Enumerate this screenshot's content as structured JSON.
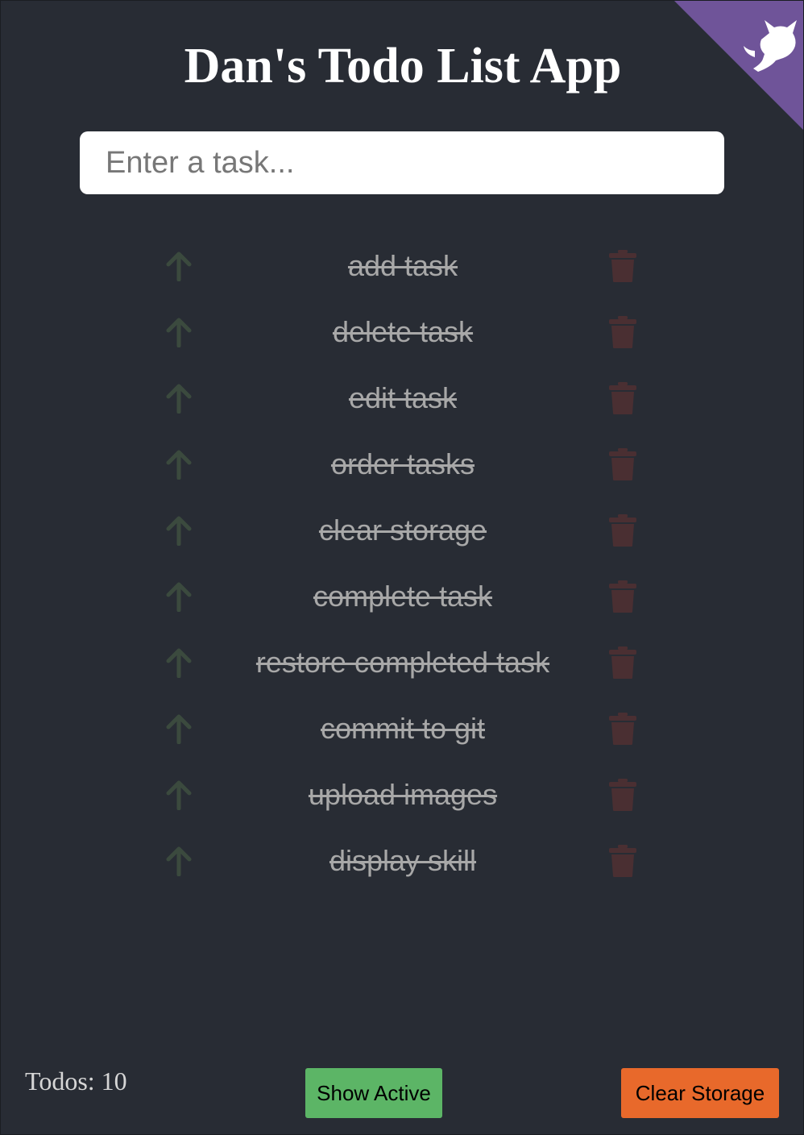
{
  "app": {
    "title": "Dan's Todo List App",
    "accent_corner_color": "#6f5499",
    "corner_icon": "github-cat-icon"
  },
  "input": {
    "placeholder": "Enter a task...",
    "value": ""
  },
  "todos": [
    {
      "text": "add task",
      "completed": true
    },
    {
      "text": "delete task",
      "completed": true
    },
    {
      "text": "edit task",
      "completed": true
    },
    {
      "text": "order tasks",
      "completed": true
    },
    {
      "text": "clear storage",
      "completed": true
    },
    {
      "text": "complete task",
      "completed": true
    },
    {
      "text": "restore completed task",
      "completed": true
    },
    {
      "text": "commit to git",
      "completed": true
    },
    {
      "text": "upload images",
      "completed": true
    },
    {
      "text": "display skill",
      "completed": true
    }
  ],
  "row_icons": {
    "move_up": "arrow-up-icon",
    "delete": "trash-icon"
  },
  "footer": {
    "count_label": "Todos: 10",
    "show_active_label": "Show Active",
    "clear_storage_label": "Clear Storage"
  },
  "colors": {
    "background": "#282c34",
    "show_active": "#5cb566",
    "clear_storage": "#e8692b",
    "arrow_dim": "#3b4a3e",
    "trash_dim": "#4a2f32"
  }
}
